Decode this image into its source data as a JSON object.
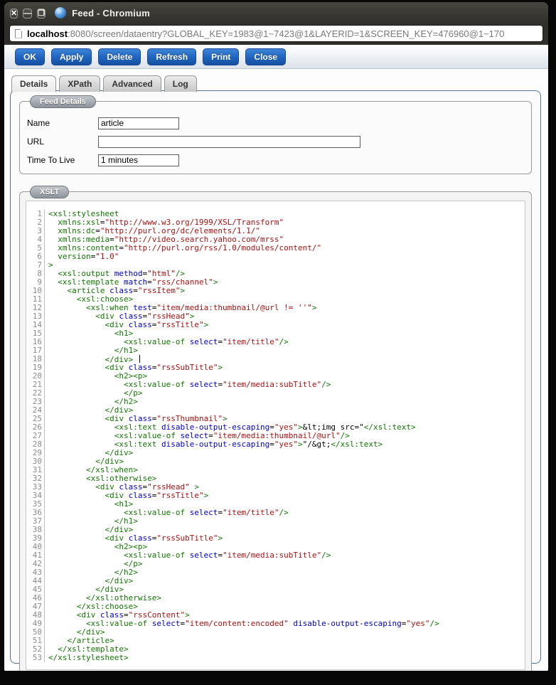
{
  "window": {
    "title": "Feed - Chromium",
    "controls": [
      {
        "name": "close",
        "glyph": "✕"
      },
      {
        "name": "minimize",
        "glyph": "—"
      },
      {
        "name": "maximize",
        "glyph": "❐"
      }
    ]
  },
  "address_bar": {
    "host": "localhost",
    "rest": ":8080/screen/dataentry?GLOBAL_KEY=1983@1~7423@1&LAYERID=1&SCREEN_KEY=476960@1~170"
  },
  "toolbar": {
    "buttons": [
      "OK",
      "Apply",
      "Delete",
      "Refresh",
      "Print",
      "Close"
    ]
  },
  "tabs": [
    {
      "label": "Details",
      "active": true
    },
    {
      "label": "XPath",
      "active": false
    },
    {
      "label": "Advanced",
      "active": false
    },
    {
      "label": "Log",
      "active": false
    }
  ],
  "feed_details": {
    "legend": "Feed Details",
    "fields": [
      {
        "label": "Name",
        "value": "article",
        "size": "s"
      },
      {
        "label": "URL",
        "value": "",
        "size": "l"
      },
      {
        "label": "Time To Live",
        "value": "1 minutes",
        "size": "s"
      }
    ]
  },
  "xslt": {
    "legend": "XSLT",
    "caret_line": 18,
    "colors": {
      "tag": "#117700",
      "attr": "#0000cc",
      "string": "#aa1111",
      "plain": "#000000",
      "line_number": "#8a8a8a"
    },
    "lines": [
      [
        [
          "t",
          "<xsl:stylesheet"
        ]
      ],
      [
        [
          "p",
          "  "
        ],
        [
          "t",
          "xmlns:xsl"
        ],
        [
          "p",
          "="
        ],
        [
          "s",
          "\"http://www.w3.org/1999/XSL/Transform\""
        ]
      ],
      [
        [
          "p",
          "  "
        ],
        [
          "t",
          "xmlns:dc"
        ],
        [
          "p",
          "="
        ],
        [
          "s",
          "\"http://purl.org/dc/elements/1.1/\""
        ]
      ],
      [
        [
          "p",
          "  "
        ],
        [
          "t",
          "xmlns:media"
        ],
        [
          "p",
          "="
        ],
        [
          "s",
          "\"http://video.search.yahoo.com/mrss\""
        ]
      ],
      [
        [
          "p",
          "  "
        ],
        [
          "t",
          "xmlns:content"
        ],
        [
          "p",
          "="
        ],
        [
          "s",
          "\"http://purl.org/rss/1.0/modules/content/\""
        ]
      ],
      [
        [
          "p",
          "  "
        ],
        [
          "t",
          "version"
        ],
        [
          "p",
          "="
        ],
        [
          "s",
          "\"1.0\""
        ]
      ],
      [
        [
          "t",
          ">"
        ]
      ],
      [
        [
          "p",
          "  "
        ],
        [
          "t",
          "<xsl:output"
        ],
        [
          "p",
          " "
        ],
        [
          "a",
          "method"
        ],
        [
          "p",
          "="
        ],
        [
          "s",
          "\"html\""
        ],
        [
          "t",
          "/>"
        ]
      ],
      [
        [
          "p",
          "  "
        ],
        [
          "t",
          "<xsl:template"
        ],
        [
          "p",
          " "
        ],
        [
          "a",
          "match"
        ],
        [
          "p",
          "="
        ],
        [
          "s",
          "\"rss/channel\""
        ],
        [
          "t",
          ">"
        ]
      ],
      [
        [
          "p",
          "    "
        ],
        [
          "t",
          "<article"
        ],
        [
          "p",
          " "
        ],
        [
          "a",
          "class"
        ],
        [
          "p",
          "="
        ],
        [
          "s",
          "\"rssItem\""
        ],
        [
          "t",
          ">"
        ]
      ],
      [
        [
          "p",
          "      "
        ],
        [
          "t",
          "<xsl:choose>"
        ]
      ],
      [
        [
          "p",
          "        "
        ],
        [
          "t",
          "<xsl:when"
        ],
        [
          "p",
          " "
        ],
        [
          "a",
          "test"
        ],
        [
          "p",
          "="
        ],
        [
          "s",
          "\"item/media:thumbnail/@url != ''\""
        ],
        [
          "t",
          ">"
        ]
      ],
      [
        [
          "p",
          "          "
        ],
        [
          "t",
          "<div"
        ],
        [
          "p",
          " "
        ],
        [
          "a",
          "class"
        ],
        [
          "p",
          "="
        ],
        [
          "s",
          "\"rssHead\""
        ],
        [
          "t",
          ">"
        ]
      ],
      [
        [
          "p",
          "            "
        ],
        [
          "t",
          "<div"
        ],
        [
          "p",
          " "
        ],
        [
          "a",
          "class"
        ],
        [
          "p",
          "="
        ],
        [
          "s",
          "\"rssTitle\""
        ],
        [
          "t",
          ">"
        ]
      ],
      [
        [
          "p",
          "              "
        ],
        [
          "t",
          "<h1>"
        ]
      ],
      [
        [
          "p",
          "                "
        ],
        [
          "t",
          "<xsl:value-of"
        ],
        [
          "p",
          " "
        ],
        [
          "a",
          "select"
        ],
        [
          "p",
          "="
        ],
        [
          "s",
          "\"item/title\""
        ],
        [
          "t",
          "/>"
        ]
      ],
      [
        [
          "p",
          "              "
        ],
        [
          "t",
          "</h1>"
        ]
      ],
      [
        [
          "p",
          "            "
        ],
        [
          "t",
          "</div>"
        ]
      ],
      [
        [
          "p",
          "            "
        ],
        [
          "t",
          "<div"
        ],
        [
          "p",
          " "
        ],
        [
          "a",
          "class"
        ],
        [
          "p",
          "="
        ],
        [
          "s",
          "\"rssSubTitle\""
        ],
        [
          "t",
          ">"
        ]
      ],
      [
        [
          "p",
          "              "
        ],
        [
          "t",
          "<h2><p>"
        ]
      ],
      [
        [
          "p",
          "                "
        ],
        [
          "t",
          "<xsl:value-of"
        ],
        [
          "p",
          " "
        ],
        [
          "a",
          "select"
        ],
        [
          "p",
          "="
        ],
        [
          "s",
          "\"item/media:subTitle\""
        ],
        [
          "t",
          "/>"
        ]
      ],
      [
        [
          "p",
          "                "
        ],
        [
          "t",
          "</p>"
        ]
      ],
      [
        [
          "p",
          "              "
        ],
        [
          "t",
          "</h2>"
        ]
      ],
      [
        [
          "p",
          "            "
        ],
        [
          "t",
          "</div>"
        ]
      ],
      [
        [
          "p",
          "            "
        ],
        [
          "t",
          "<div"
        ],
        [
          "p",
          " "
        ],
        [
          "a",
          "class"
        ],
        [
          "p",
          "="
        ],
        [
          "s",
          "\"rssThumbnail\""
        ],
        [
          "t",
          ">"
        ]
      ],
      [
        [
          "p",
          "              "
        ],
        [
          "t",
          "<xsl:text"
        ],
        [
          "p",
          " "
        ],
        [
          "a",
          "disable-output-escaping"
        ],
        [
          "p",
          "="
        ],
        [
          "s",
          "\"yes\""
        ],
        [
          "t",
          ">"
        ],
        [
          "p",
          "&lt;img src=\""
        ],
        [
          "t",
          "</xsl:text>"
        ]
      ],
      [
        [
          "p",
          "              "
        ],
        [
          "t",
          "<xsl:value-of"
        ],
        [
          "p",
          " "
        ],
        [
          "a",
          "select"
        ],
        [
          "p",
          "="
        ],
        [
          "s",
          "\"item/media:thumbnail/@url\""
        ],
        [
          "t",
          "/>"
        ]
      ],
      [
        [
          "p",
          "              "
        ],
        [
          "t",
          "<xsl:text"
        ],
        [
          "p",
          " "
        ],
        [
          "a",
          "disable-output-escaping"
        ],
        [
          "p",
          "="
        ],
        [
          "s",
          "\"yes\""
        ],
        [
          "t",
          ">"
        ],
        [
          "p",
          "\"/&gt;"
        ],
        [
          "t",
          "</xsl:text>"
        ]
      ],
      [
        [
          "p",
          "            "
        ],
        [
          "t",
          "</div>"
        ]
      ],
      [
        [
          "p",
          "          "
        ],
        [
          "t",
          "</div>"
        ]
      ],
      [
        [
          "p",
          "        "
        ],
        [
          "t",
          "</xsl:when>"
        ]
      ],
      [
        [
          "p",
          "        "
        ],
        [
          "t",
          "<xsl:otherwise>"
        ]
      ],
      [
        [
          "p",
          "          "
        ],
        [
          "t",
          "<div"
        ],
        [
          "p",
          " "
        ],
        [
          "a",
          "class"
        ],
        [
          "p",
          "="
        ],
        [
          "s",
          "\"rssHead\""
        ],
        [
          "p",
          " "
        ],
        [
          "t",
          ">"
        ]
      ],
      [
        [
          "p",
          "            "
        ],
        [
          "t",
          "<div"
        ],
        [
          "p",
          " "
        ],
        [
          "a",
          "class"
        ],
        [
          "p",
          "="
        ],
        [
          "s",
          "\"rssTitle\""
        ],
        [
          "t",
          ">"
        ]
      ],
      [
        [
          "p",
          "              "
        ],
        [
          "t",
          "<h1>"
        ]
      ],
      [
        [
          "p",
          "                "
        ],
        [
          "t",
          "<xsl:value-of"
        ],
        [
          "p",
          " "
        ],
        [
          "a",
          "select"
        ],
        [
          "p",
          "="
        ],
        [
          "s",
          "\"item/title\""
        ],
        [
          "t",
          "/>"
        ]
      ],
      [
        [
          "p",
          "              "
        ],
        [
          "t",
          "</h1>"
        ]
      ],
      [
        [
          "p",
          "            "
        ],
        [
          "t",
          "</div>"
        ]
      ],
      [
        [
          "p",
          "            "
        ],
        [
          "t",
          "<div"
        ],
        [
          "p",
          " "
        ],
        [
          "a",
          "class"
        ],
        [
          "p",
          "="
        ],
        [
          "s",
          "\"rssSubTitle\""
        ],
        [
          "t",
          ">"
        ]
      ],
      [
        [
          "p",
          "              "
        ],
        [
          "t",
          "<h2><p>"
        ]
      ],
      [
        [
          "p",
          "                "
        ],
        [
          "t",
          "<xsl:value-of"
        ],
        [
          "p",
          " "
        ],
        [
          "a",
          "select"
        ],
        [
          "p",
          "="
        ],
        [
          "s",
          "\"item/media:subTitle\""
        ],
        [
          "t",
          "/>"
        ]
      ],
      [
        [
          "p",
          "                "
        ],
        [
          "t",
          "</p>"
        ]
      ],
      [
        [
          "p",
          "              "
        ],
        [
          "t",
          "</h2>"
        ]
      ],
      [
        [
          "p",
          "            "
        ],
        [
          "t",
          "</div>"
        ]
      ],
      [
        [
          "p",
          "          "
        ],
        [
          "t",
          "</div>"
        ]
      ],
      [
        [
          "p",
          "        "
        ],
        [
          "t",
          "</xsl:otherwise>"
        ]
      ],
      [
        [
          "p",
          "      "
        ],
        [
          "t",
          "</xsl:choose>"
        ]
      ],
      [
        [
          "p",
          "      "
        ],
        [
          "t",
          "<div"
        ],
        [
          "p",
          " "
        ],
        [
          "a",
          "class"
        ],
        [
          "p",
          "="
        ],
        [
          "s",
          "\"rssContent\""
        ],
        [
          "t",
          ">"
        ]
      ],
      [
        [
          "p",
          "        "
        ],
        [
          "t",
          "<xsl:value-of"
        ],
        [
          "p",
          " "
        ],
        [
          "a",
          "select"
        ],
        [
          "p",
          "="
        ],
        [
          "s",
          "\"item/content:encoded\""
        ],
        [
          "p",
          " "
        ],
        [
          "a",
          "disable-output-escaping"
        ],
        [
          "p",
          "="
        ],
        [
          "s",
          "\"yes\""
        ],
        [
          "t",
          "/>"
        ]
      ],
      [
        [
          "p",
          "      "
        ],
        [
          "t",
          "</div>"
        ]
      ],
      [
        [
          "p",
          "    "
        ],
        [
          "t",
          "</article>"
        ]
      ],
      [
        [
          "p",
          "  "
        ],
        [
          "t",
          "</xsl:template>"
        ]
      ],
      [
        [
          "t",
          "</xsl:stylesheet>"
        ]
      ]
    ]
  }
}
